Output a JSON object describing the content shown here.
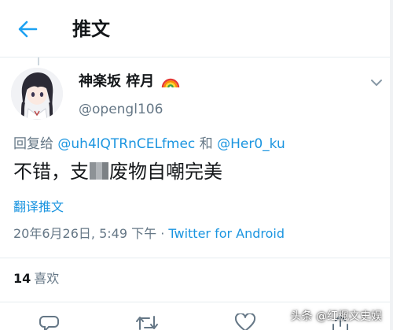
{
  "header": {
    "back_icon": "arrow-left-icon",
    "title": "推文"
  },
  "tweet": {
    "author": {
      "display_name": "神楽坂 梓月",
      "emoji_icon": "rainbow-icon",
      "handle": "@opengl106"
    },
    "reply_to": {
      "prefix": "回复给",
      "mention1": "@uh4lQTRnCELfmec",
      "conjunction": "和",
      "mention2": "@Her0_ku"
    },
    "text_before": "不错，支",
    "text_after": "废物自嘲完美",
    "translate_label": "翻译推文",
    "timestamp": "20年6月26日, 5:49 下午",
    "separator": "·",
    "source": "Twitter for Android",
    "likes_count": "14",
    "likes_label": "喜欢"
  },
  "actions": [
    "reply-icon",
    "retweet-icon",
    "like-icon",
    "share-icon"
  ],
  "watermark": "头条 @红楓文史娱",
  "colors": {
    "accent": "#1b95e0",
    "text": "#14171a",
    "muted": "#657786",
    "divider": "#e6ecf0"
  }
}
